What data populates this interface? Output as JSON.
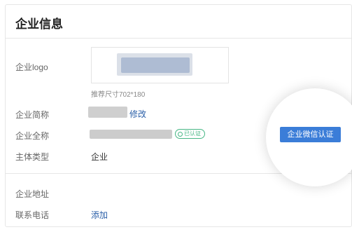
{
  "title": "企业信息",
  "fields": {
    "logo_label": "企业logo",
    "logo_hint": "推荐尺寸702*180",
    "short_name_label": "企业简称",
    "short_name_action": "修改",
    "full_name_label": "企业全称",
    "verified_badge": "已认证",
    "type_label": "主体类型",
    "type_value": "企业",
    "address_label": "企业地址",
    "phone_label": "联系电话",
    "phone_action": "添加"
  },
  "wechat_verify_button": "企业微信认证",
  "colors": {
    "accent": "#3b7dd8",
    "link": "#2a5fa8",
    "verified": "#47b785"
  }
}
